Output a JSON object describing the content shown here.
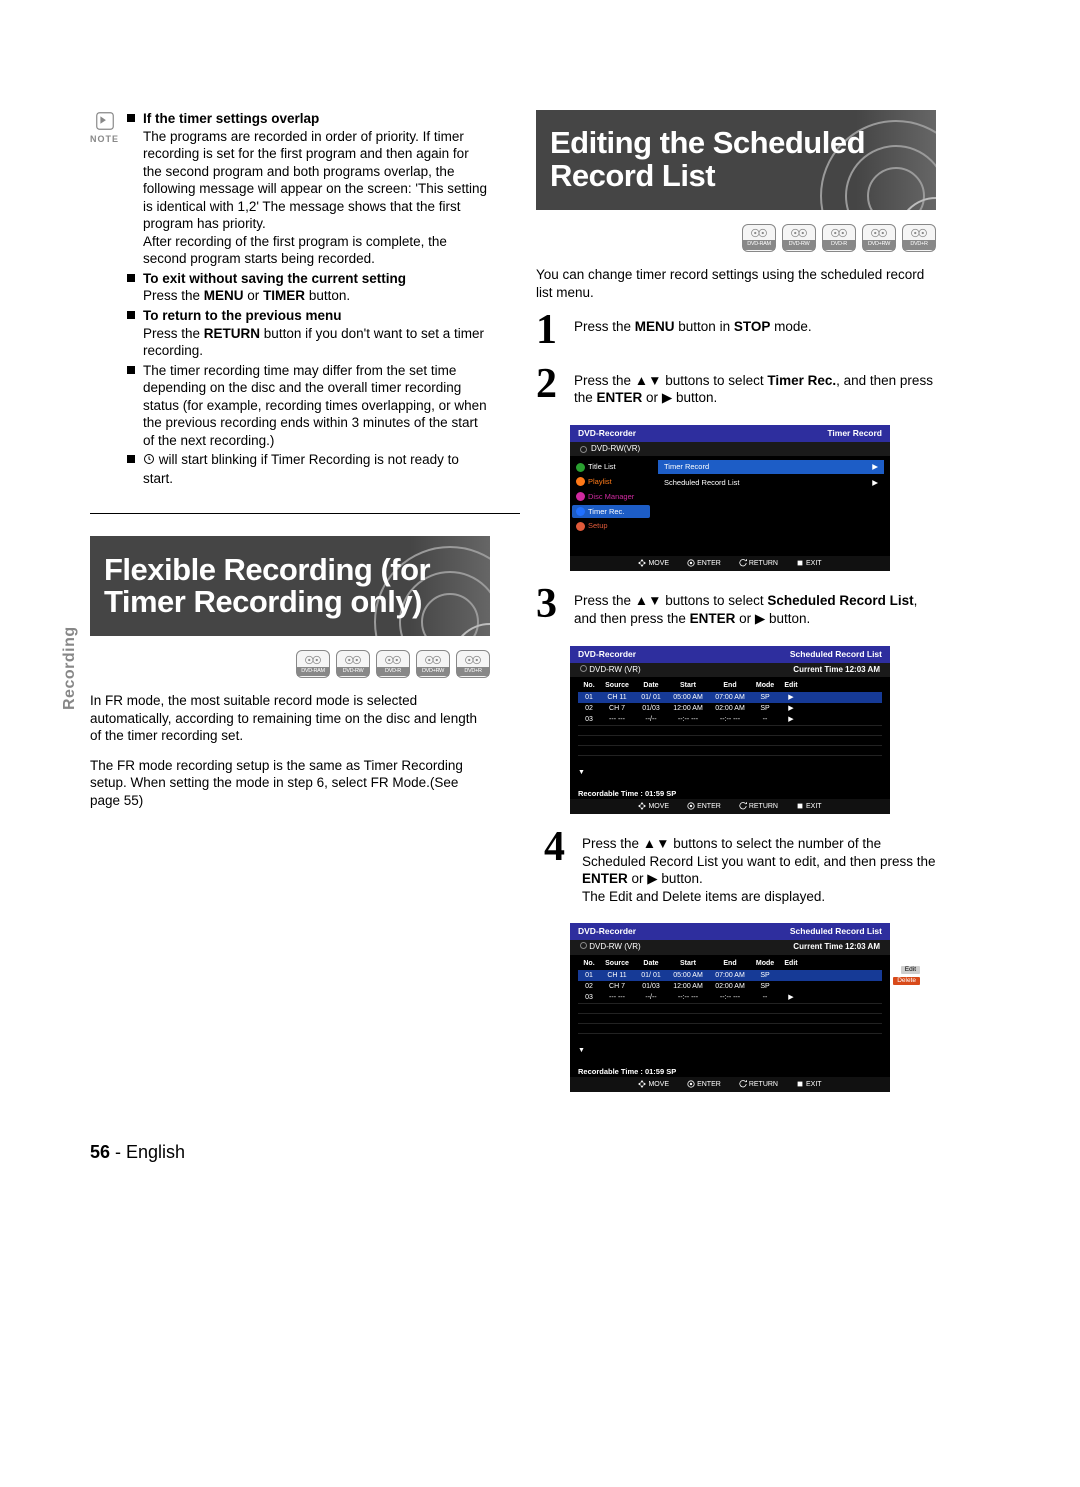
{
  "sideTab": "Recording",
  "note": {
    "label": "NOTE",
    "items": [
      {
        "title": "If the timer settings overlap",
        "body": "The programs are recorded in order of priority. If timer recording is set for the first program and then again for the second program and both programs overlap, the following message will appear on the screen: 'This setting is identical with 1,2' The message shows that the first program has priority.",
        "body2": "After recording of the first program is complete, the second program starts being recorded."
      },
      {
        "title": "To exit without saving the current setting",
        "body": "Press the MENU or TIMER button."
      },
      {
        "title": "To return to the previous menu",
        "body": "Press the RETURN button if you don't want to set a timer recording."
      },
      {
        "title": "",
        "body": "The timer recording time may differ from the set time depending on the disc and the overall timer recording status (for example, recording times overlapping, or when the previous recording ends within 3 minutes of the start of the next recording.)"
      },
      {
        "title": "",
        "body": " will start blinking if Timer Recording is not ready to start.",
        "icon": "clock"
      }
    ]
  },
  "sectionFlexible": {
    "title": "Flexible Recording (for Timer Recording only)",
    "discs": [
      "DVD-RAM",
      "DVD-RW",
      "DVD-R",
      "DVD+RW",
      "DVD+R"
    ],
    "p1": "In FR mode, the most suitable record mode is selected automatically, according to remaining time on the disc and length of the timer recording set.",
    "p2": "The FR mode recording setup is the same as Timer Recording setup. When setting the mode in step 6, select FR Mode.(See page 55)"
  },
  "sectionEditing": {
    "title": "Editing the Scheduled Record List",
    "discs": [
      "DVD-RAM",
      "DVD-RW",
      "DVD-R",
      "DVD+RW",
      "DVD+R"
    ],
    "intro": "You can change timer record settings using the scheduled record list menu.",
    "steps": {
      "s1": {
        "n": "1",
        "t1": "Press the ",
        "b1": "MENU",
        "t2": " button in ",
        "b2": "STOP",
        "t3": " mode."
      },
      "s2": {
        "n": "2",
        "t1": "Press the ",
        "arrows": "▲▼",
        "t2": " buttons to select ",
        "b1": "Timer Rec.",
        "t3": ", and then press the ",
        "b2": "ENTER",
        "t4": " or ",
        "play": "▶",
        "t5": " button."
      },
      "s3": {
        "n": "3",
        "t1": "Press the ",
        "arrows": "▲▼",
        "t2": " buttons to select ",
        "b1": "Scheduled Record List",
        "t3": ", and then press the ",
        "b2": "ENTER",
        "t4": " or ",
        "play": "▶",
        "t5": " button."
      },
      "s4": {
        "n": "4",
        "t1": "Press the ",
        "arrows": "▲▼",
        "t2": " buttons to select the number of the Scheduled Record List you want to edit, and then press the ",
        "b1": "ENTER",
        "t3": " or ",
        "play": "▶",
        "t4": " button.",
        "line2": "The Edit and Delete items are displayed."
      }
    }
  },
  "osd1": {
    "headL": "DVD-Recorder",
    "headR": "Timer Record",
    "sub": "DVD-RW(VR)",
    "menu": [
      {
        "label": "Title List",
        "c": "#2aa030"
      },
      {
        "label": "Playlist",
        "c": "#ff7a18"
      },
      {
        "label": "Disc Manager",
        "c": "#d02aa0"
      },
      {
        "label": "Timer Rec.",
        "c": "#2070ff",
        "sel": true
      },
      {
        "label": "Setup",
        "c": "#e05a3a"
      }
    ],
    "content": [
      {
        "label": "Timer Record",
        "arrow": "▶"
      },
      {
        "label": "Scheduled Record List",
        "arrow": "▶"
      }
    ],
    "foot": {
      "move": "MOVE",
      "enter": "ENTER",
      "return": "RETURN",
      "exit": "EXIT"
    }
  },
  "osd2": {
    "headL": "DVD-Recorder",
    "headR": "Scheduled Record List",
    "sub": "DVD-RW (VR)",
    "currentTime": "Current Time  12:03 AM",
    "th": [
      "No.",
      "Source",
      "Date",
      "Start",
      "End",
      "Mode",
      "Edit"
    ],
    "rows": [
      {
        "no": "01",
        "src": "CH 11",
        "date": "01/ 01",
        "start": "05:00 AM",
        "end": "07:00 AM",
        "mode": "SP",
        "arrow": "▶",
        "sel": true
      },
      {
        "no": "02",
        "src": "CH 7",
        "date": "01/03",
        "start": "12:00 AM",
        "end": "02:00 AM",
        "mode": "SP",
        "arrow": "▶"
      },
      {
        "no": "03",
        "src": "--- ---",
        "date": "--/--",
        "start": "--:-- ---",
        "end": "--:-- ---",
        "mode": "--",
        "arrow": "▶"
      }
    ],
    "rectime": "Recordable Time :  01:59  SP",
    "foot": {
      "move": "MOVE",
      "enter": "ENTER",
      "return": "RETURN",
      "exit": "EXIT"
    }
  },
  "osd3": {
    "headL": "DVD-Recorder",
    "headR": "Scheduled Record List",
    "sub": "DVD-RW (VR)",
    "currentTime": "Current Time  12:03 AM",
    "th": [
      "No.",
      "Source",
      "Date",
      "Start",
      "End",
      "Mode",
      "Edit"
    ],
    "rows": [
      {
        "no": "01",
        "src": "CH 11",
        "date": "01/ 01",
        "start": "05:00 AM",
        "end": "07:00 AM",
        "mode": "SP",
        "arrow": "Edit",
        "sel": true,
        "pop": "Edit"
      },
      {
        "no": "02",
        "src": "CH 7",
        "date": "01/03",
        "start": "12:00 AM",
        "end": "02:00 AM",
        "mode": "SP",
        "arrow": "",
        "pop": "Delete"
      },
      {
        "no": "03",
        "src": "--- ---",
        "date": "--/--",
        "start": "--:-- ---",
        "end": "--:-- ---",
        "mode": "--",
        "arrow": "▶"
      }
    ],
    "rectime": "Recordable Time :  01:59  SP",
    "foot": {
      "move": "MOVE",
      "enter": "ENTER",
      "return": "RETURN",
      "exit": "EXIT"
    }
  },
  "footer": {
    "page": "56",
    "sep": " - ",
    "lang": "English"
  }
}
